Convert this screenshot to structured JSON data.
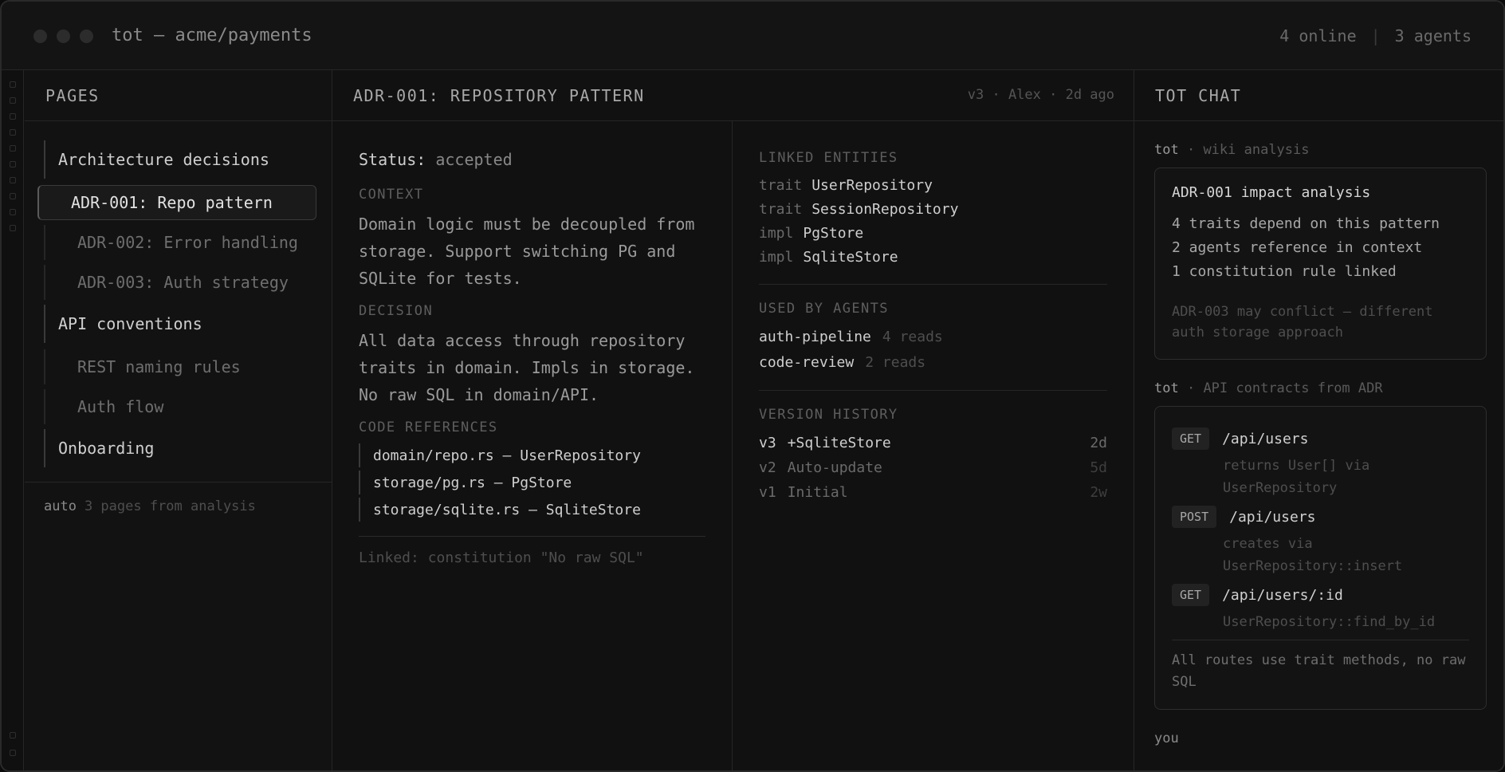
{
  "window": {
    "title": "tot — acme/payments",
    "online": "4 online",
    "separator": "|",
    "agents": "3 agents"
  },
  "pages": {
    "header": "PAGES",
    "groups": [
      {
        "label": "Architecture decisions",
        "items": [
          "ADR-001: Repo pattern",
          "ADR-002: Error handling",
          "ADR-003: Auth strategy"
        ]
      },
      {
        "label": "API conventions",
        "items": [
          "REST naming rules",
          "Auth flow"
        ]
      },
      {
        "label": "Onboarding",
        "items": []
      }
    ],
    "footer_strong": "auto",
    "footer_text": "3 pages from analysis"
  },
  "doc": {
    "title": "ADR-001: REPOSITORY PATTERN",
    "meta": "v3 · Alex · 2d ago",
    "status_label": "Status:",
    "status_value": "accepted",
    "context_label": "CONTEXT",
    "context_text": "Domain logic must be decoupled from storage. Support switching PG and SQLite for tests.",
    "decision_label": "DECISION",
    "decision_text": "All data access through repository traits in domain. Impls in storage. No raw SQL in domain/API.",
    "code_label": "CODE REFERENCES",
    "code_refs": [
      "domain/repo.rs — UserRepository",
      "storage/pg.rs — PgStore",
      "storage/sqlite.rs — SqliteStore"
    ],
    "linked_note": "Linked: constitution \"No raw SQL\"",
    "linked_entities_label": "LINKED ENTITIES",
    "linked_entities": [
      {
        "kind": "trait",
        "name": "UserRepository"
      },
      {
        "kind": "trait",
        "name": "SessionRepository"
      },
      {
        "kind": "impl",
        "name": "PgStore"
      },
      {
        "kind": "impl",
        "name": "SqliteStore"
      }
    ],
    "used_by_label": "USED BY AGENTS",
    "used_by": [
      {
        "name": "auth-pipeline",
        "reads": "4 reads"
      },
      {
        "name": "code-review",
        "reads": "2 reads"
      }
    ],
    "history_label": "VERSION HISTORY",
    "history": [
      {
        "v": "v3",
        "text": "+SqliteStore",
        "age": "2d"
      },
      {
        "v": "v2",
        "text": "Auto-update",
        "age": "5d"
      },
      {
        "v": "v1",
        "text": "Initial",
        "age": "2w"
      }
    ]
  },
  "chat": {
    "header": "TOT CHAT",
    "msg1": {
      "who": "tot",
      "topic": "· wiki analysis",
      "title": "ADR-001 impact analysis",
      "lines": [
        "4 traits depend on this pattern",
        "2 agents reference in context",
        "1 constitution rule linked"
      ],
      "note": "ADR-003 may conflict — different auth storage approach"
    },
    "msg2": {
      "who": "tot",
      "topic": "· API contracts from ADR",
      "routes": [
        {
          "method": "GET",
          "path": "/api/users",
          "desc": "returns User[] via UserRepository"
        },
        {
          "method": "POST",
          "path": "/api/users",
          "desc": "creates via UserRepository::insert"
        },
        {
          "method": "GET",
          "path": "/api/users/:id",
          "desc": "UserRepository::find_by_id"
        }
      ],
      "foot": "All routes use trait methods, no raw SQL"
    },
    "you": "you"
  }
}
